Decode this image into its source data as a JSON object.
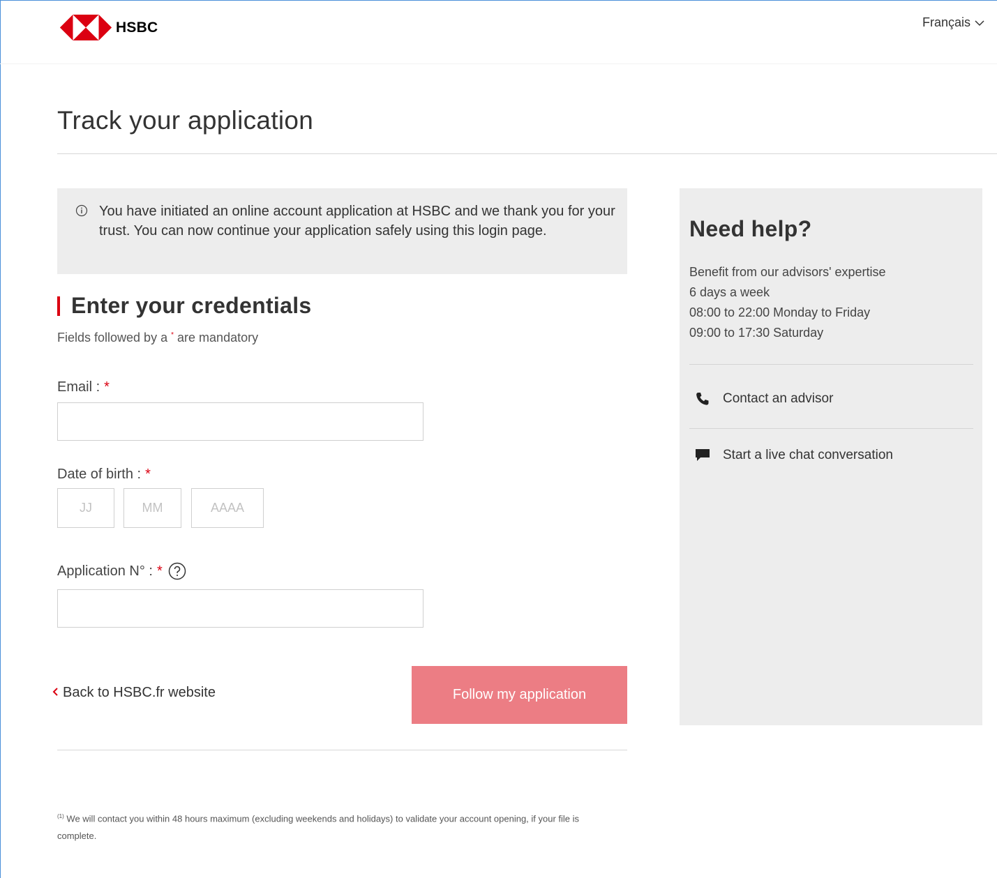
{
  "header": {
    "brand": "HSBC",
    "language": "Français"
  },
  "page": {
    "title": "Track your application"
  },
  "info": {
    "message": "You have initiated an online account application at HSBC and we thank you for your trust. You can now continue your application safely using this login page."
  },
  "form": {
    "section_title": "Enter your credentials",
    "mandatory_prefix": "Fields followed by a",
    "mandatory_star": "*",
    "mandatory_suffix": "are mandatory",
    "email_label": "Email :",
    "email_value": "",
    "dob_label": "Date of birth :",
    "dob_day_placeholder": "JJ",
    "dob_month_placeholder": "MM",
    "dob_year_placeholder": "AAAA",
    "app_label": "Application N° :",
    "app_value": "",
    "required_mark": "*",
    "back_link": "Back to HSBC.fr website",
    "submit_label": "Follow my application",
    "footnote_mark": "(1)",
    "footnote": "We will contact you within 48 hours maximum (excluding weekends and holidays) to validate your account opening, if your file is complete."
  },
  "help": {
    "title": "Need help?",
    "lines": [
      "Benefit from our advisors' expertise",
      "6 days a week",
      "08:00 to 22:00 Monday to Friday",
      "09:00 to 17:30 Saturday"
    ],
    "contact_label": "Contact an advisor",
    "chat_label": "Start a live chat conversation"
  },
  "colors": {
    "brand_red": "#db0011",
    "button_bg": "#ec7d84",
    "panel_bg": "#ededed"
  },
  "icons": [
    "hsbc-logo",
    "chevron-down-icon",
    "info-icon",
    "help-circle-icon",
    "chevron-left-icon",
    "phone-icon",
    "chat-icon"
  ]
}
